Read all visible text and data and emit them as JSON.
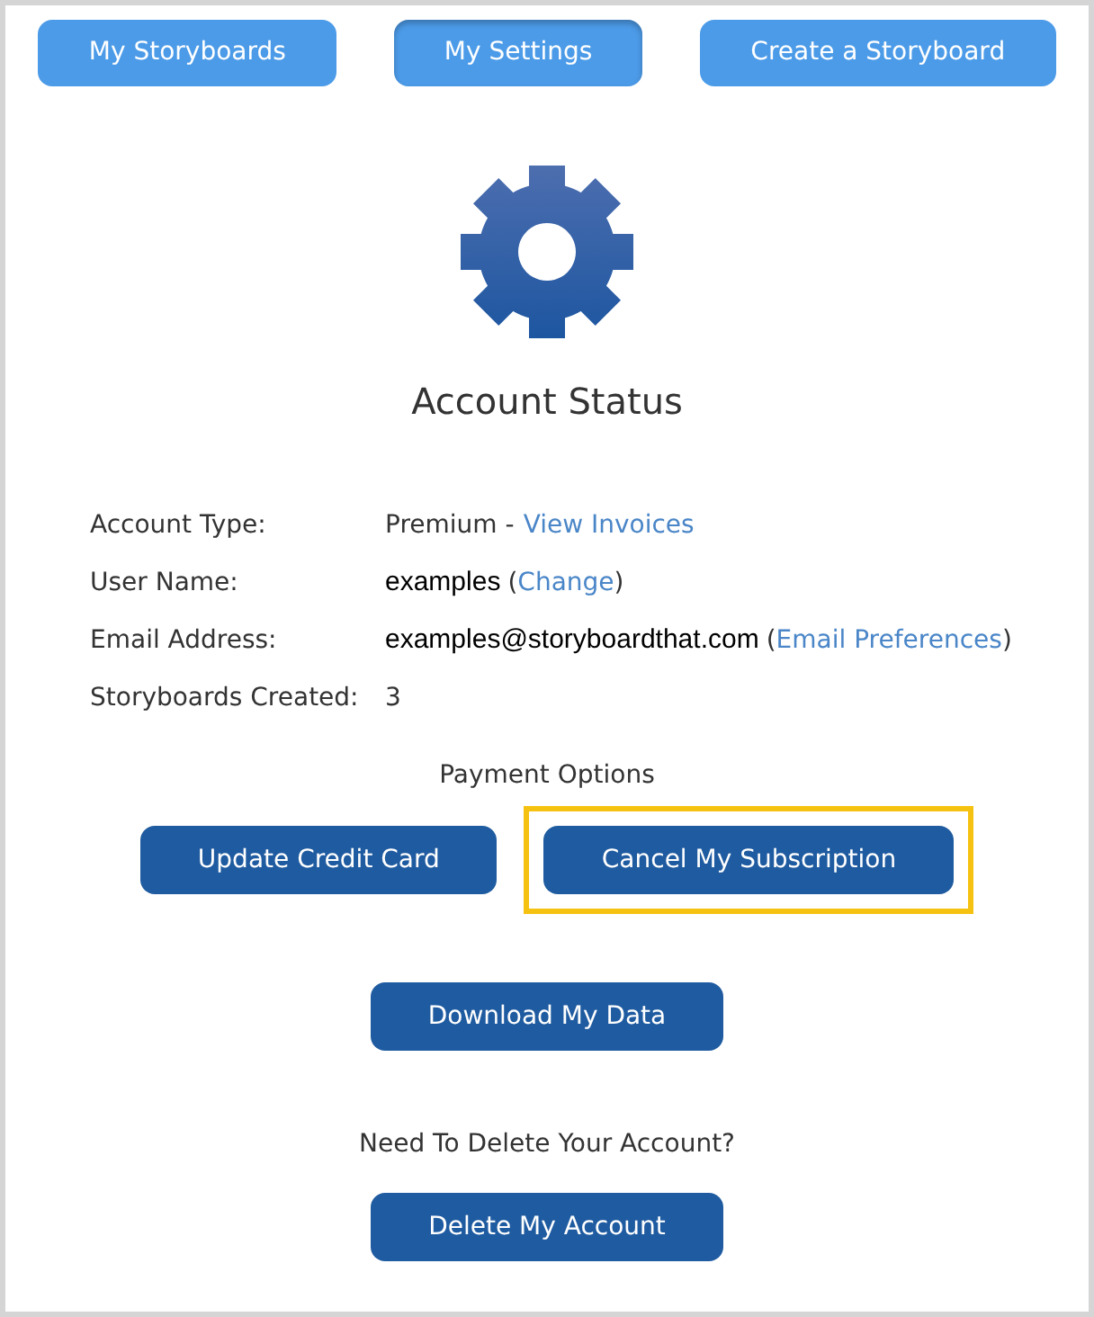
{
  "nav": [
    {
      "label": "My Storyboards",
      "selected": false
    },
    {
      "label": "My Settings",
      "selected": true
    },
    {
      "label": "Create a Storyboard",
      "selected": false
    }
  ],
  "title": "Account Status",
  "details": [
    {
      "label": "Account Type:",
      "value": "Premium -",
      "kind": "dash",
      "link": "View Invoices"
    },
    {
      "label": "User Name:",
      "value": "examples",
      "kind": "paren",
      "open": "(",
      "link": "Change",
      "close": ")"
    },
    {
      "label": "Email Address:",
      "value": "examples@storyboardthat.com",
      "kind": "paren",
      "open": "(",
      "link": "Email Preferences",
      "close": ")"
    },
    {
      "label": "Storyboards Created:",
      "value": "3",
      "kind": "plain"
    }
  ],
  "payment": {
    "heading": "Payment Options",
    "buttons": [
      {
        "label": "Update Credit Card",
        "highlighted": false
      },
      {
        "label": "Cancel My Subscription",
        "highlighted": true
      }
    ]
  },
  "download_button": "Download My Data",
  "delete": {
    "heading": "Need To Delete Your Account?",
    "button": "Delete My Account"
  }
}
